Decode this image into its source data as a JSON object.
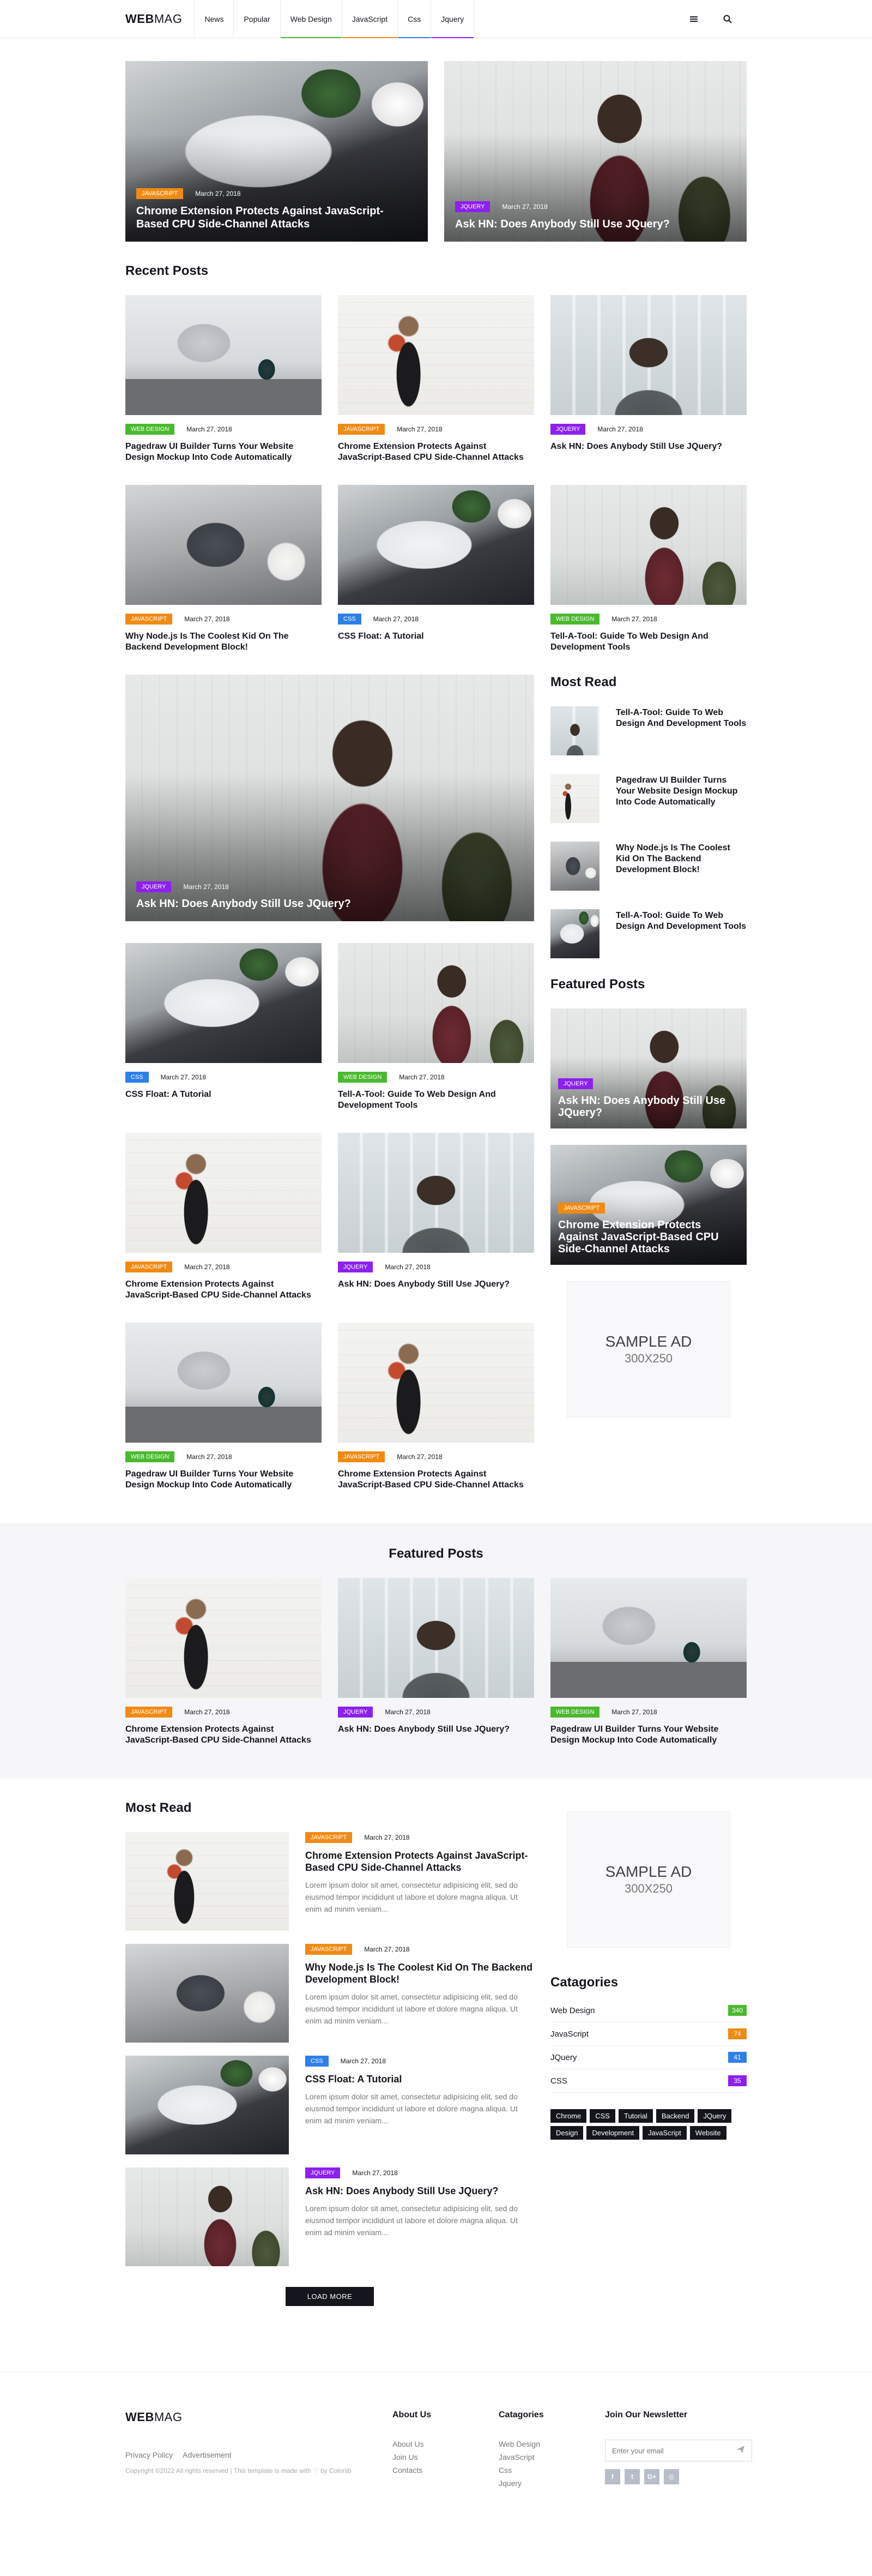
{
  "header": {
    "logo_bold": "WEB",
    "logo_thin": "MAG",
    "nav": [
      {
        "label": "News",
        "underline": ""
      },
      {
        "label": "Popular",
        "underline": ""
      },
      {
        "label": "Web Design",
        "underline": "#4bb92f"
      },
      {
        "label": "JavaScript",
        "underline": "#ef8b15"
      },
      {
        "label": "Css",
        "underline": "#2e7fe8"
      },
      {
        "label": "Jquery",
        "underline": "#8d20ed"
      }
    ],
    "menu_icon": "menu-icon",
    "search_icon": "search-icon"
  },
  "colors": {
    "webdesign": "#4bb92f",
    "javascript": "#ef8b15",
    "css": "#2e7fe8",
    "jquery": "#8d20ed",
    "dark": "#15161d"
  },
  "hero": [
    {
      "tag": "JavaScript",
      "date": "March 27, 2018",
      "title": "Chrome Extension Protects Against JavaScript-Based CPU Side-Channel Attacks"
    },
    {
      "tag": "Jquery",
      "date": "March 27, 2018",
      "title": "Ask HN: Does Anybody Still Use JQuery?"
    }
  ],
  "recent": {
    "title": "Recent Posts",
    "row1": [
      {
        "tag": "Web Design",
        "date": "March 27, 2018",
        "title": "Pagedraw UI Builder Turns Your Website Design Mockup Into Code Automatically"
      },
      {
        "tag": "JavaScript",
        "date": "March 27, 2018",
        "title": "Chrome Extension Protects Against JavaScript-Based CPU Side-Channel Attacks"
      },
      {
        "tag": "Jquery",
        "date": "March 27, 2018",
        "title": "Ask HN: Does Anybody Still Use JQuery?"
      }
    ],
    "row2": [
      {
        "tag": "JavaScript",
        "date": "March 27, 2018",
        "title": "Why Node.js Is The Coolest Kid On The Backend Development Block!"
      },
      {
        "tag": "Css",
        "date": "March 27, 2018",
        "title": "CSS Float: A Tutorial"
      },
      {
        "tag": "Web Design",
        "date": "March 27, 2018",
        "title": "Tell-A-Tool: Guide To Web Design And Development Tools"
      }
    ]
  },
  "big": {
    "tag": "Jquery",
    "date": "March 27, 2018",
    "title": "Ask HN: Does Anybody Still Use JQuery?"
  },
  "main_grid": [
    {
      "tag": "Css",
      "date": "March 27, 2018",
      "title": "CSS Float: A Tutorial"
    },
    {
      "tag": "Web Design",
      "date": "March 27, 2018",
      "title": "Tell-A-Tool: Guide To Web Design And Development Tools"
    },
    {
      "tag": "JavaScript",
      "date": "March 27, 2018",
      "title": "Chrome Extension Protects Against JavaScript-Based CPU Side-Channel Attacks"
    },
    {
      "tag": "Jquery",
      "date": "March 27, 2018",
      "title": "Ask HN: Does Anybody Still Use JQuery?"
    },
    {
      "tag": "Web Design",
      "date": "March 27, 2018",
      "title": "Pagedraw UI Builder Turns Your Website Design Mockup Into Code Automatically"
    },
    {
      "tag": "JavaScript",
      "date": "March 27, 2018",
      "title": "Chrome Extension Protects Against JavaScript-Based CPU Side-Channel Attacks"
    }
  ],
  "aside": {
    "most_read_title": "Most Read",
    "most_read": [
      {
        "title": "Tell-A-Tool: Guide To Web Design And Development Tools"
      },
      {
        "title": "Pagedraw UI Builder Turns Your Website Design Mockup Into Code Automatically"
      },
      {
        "title": "Why Node.js Is The Coolest Kid On The Backend Development Block!"
      },
      {
        "title": "Tell-A-Tool: Guide To Web Design And Development Tools"
      }
    ],
    "featured_title": "Featured Posts",
    "featured": [
      {
        "tag": "Jquery",
        "title": "Ask HN: Does Anybody Still Use JQuery?"
      },
      {
        "tag": "JavaScript",
        "title": "Chrome Extension Protects Against JavaScript-Based CPU Side-Channel Attacks"
      }
    ],
    "ad_line1": "SAMPLE AD",
    "ad_line2": "300X250"
  },
  "featured_band": {
    "title": "Featured Posts",
    "posts": [
      {
        "tag": "JavaScript",
        "date": "March 27, 2018",
        "title": "Chrome Extension Protects Against JavaScript-Based CPU Side-Channel Attacks"
      },
      {
        "tag": "Jquery",
        "date": "March 27, 2018",
        "title": "Ask HN: Does Anybody Still Use JQuery?"
      },
      {
        "tag": "Web Design",
        "date": "March 27, 2018",
        "title": "Pagedraw UI Builder Turns Your Website Design Mockup Into Code Automatically"
      }
    ]
  },
  "most_read_list": {
    "title": "Most Read",
    "items": [
      {
        "tag": "JavaScript",
        "date": "March 27, 2018",
        "title": "Chrome Extension Protects Against JavaScript-Based CPU Side-Channel Attacks",
        "excerpt": "Lorem ipsum dolor sit amet, consectetur adipisicing elit, sed do eiusmod tempor incididunt ut labore et dolore magna aliqua. Ut enim ad minim veniam..."
      },
      {
        "tag": "JavaScript",
        "date": "March 27, 2018",
        "title": "Why Node.js Is The Coolest Kid On The Backend Development Block!",
        "excerpt": "Lorem ipsum dolor sit amet, consectetur adipisicing elit, sed do eiusmod tempor incididunt ut labore et dolore magna aliqua. Ut enim ad minim veniam..."
      },
      {
        "tag": "Css",
        "date": "March 27, 2018",
        "title": "CSS Float: A Tutorial",
        "excerpt": "Lorem ipsum dolor sit amet, consectetur adipisicing elit, sed do eiusmod tempor incididunt ut labore et dolore magna aliqua. Ut enim ad minim veniam..."
      },
      {
        "tag": "Jquery",
        "date": "March 27, 2018",
        "title": "Ask HN: Does Anybody Still Use JQuery?",
        "excerpt": "Lorem ipsum dolor sit amet, consectetur adipisicing elit, sed do eiusmod tempor incididunt ut labore et dolore magna aliqua. Ut enim ad minim veniam..."
      }
    ],
    "load_more": "LOAD MORE"
  },
  "categories": {
    "title": "Catagories",
    "items": [
      {
        "label": "Web Design",
        "count": "340"
      },
      {
        "label": "JavaScript",
        "count": "74"
      },
      {
        "label": "JQuery",
        "count": "41"
      },
      {
        "label": "CSS",
        "count": "35"
      }
    ],
    "tags": [
      "Chrome",
      "CSS",
      "Tutorial",
      "Backend",
      "JQuery",
      "Design",
      "Development",
      "JavaScript",
      "Website"
    ]
  },
  "footer": {
    "logo_bold": "WEB",
    "logo_thin": "MAG",
    "privacy": "Privacy Policy",
    "advertisement": "Advertisement",
    "copyright": "Copyright ©2022 All rights reserved | This template is made with ♡ by Colorlib",
    "about_title": "About Us",
    "about_links": [
      "About Us",
      "Join Us",
      "Contacts"
    ],
    "cat_title": "Catagories",
    "cat_links": [
      "Web Design",
      "JavaScript",
      "Css",
      "Jquery"
    ],
    "newsletter_title": "Join Our Newsletter",
    "newsletter_placeholder": "Enter your email",
    "social": [
      "f",
      "t",
      "G+",
      "◎"
    ]
  }
}
